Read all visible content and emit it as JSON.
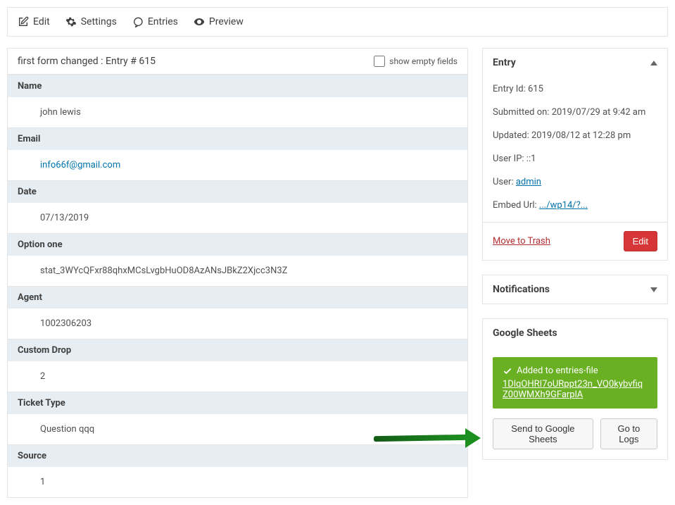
{
  "topbar": {
    "edit": "Edit",
    "settings": "Settings",
    "entries": "Entries",
    "preview": "Preview"
  },
  "entry_title": "first form changed : Entry # 615",
  "show_empty_label": "show empty fields",
  "fields": [
    {
      "label": "Name",
      "value": "john lewis",
      "link": false
    },
    {
      "label": "Email",
      "value": "info66f@gmail.com",
      "link": true
    },
    {
      "label": "Date",
      "value": "07/13/2019",
      "link": false
    },
    {
      "label": "Option one",
      "value": "stat_3WYcQFxr88qhxMCsLvgbHuOD8AzANsJBkZ2Xjcc3N3Z",
      "link": false
    },
    {
      "label": "Agent",
      "value": "1002306203",
      "link": false
    },
    {
      "label": "Custom Drop",
      "value": "2",
      "link": false
    },
    {
      "label": "Ticket Type",
      "value": "Question qqq",
      "link": false
    },
    {
      "label": "Source",
      "value": "1",
      "link": false
    }
  ],
  "sidebar": {
    "entry_panel": {
      "title": "Entry",
      "entry_id_label": "Entry Id:",
      "entry_id": "615",
      "submitted_label": "Submitted on:",
      "submitted": "2019/07/29 at 9:42 am",
      "updated_label": "Updated:",
      "updated": "2019/08/12 at 12:28 pm",
      "userip_label": "User IP:",
      "userip": "::1",
      "user_label": "User:",
      "user": "admin",
      "embed_label": "Embed Url:",
      "embed": ".../wp14/?...",
      "trash": "Move to Trash",
      "edit_btn": "Edit"
    },
    "notifications": {
      "title": "Notifications"
    },
    "sheets": {
      "title": "Google Sheets",
      "added_text": "Added to entries-file",
      "sheet_id": "1DlqOHRI7oURppt23n_VQ0kybvfiqZ00WMXh9GFarplA",
      "send_btn": "Send to Google Sheets",
      "logs_btn": "Go to Logs"
    }
  }
}
